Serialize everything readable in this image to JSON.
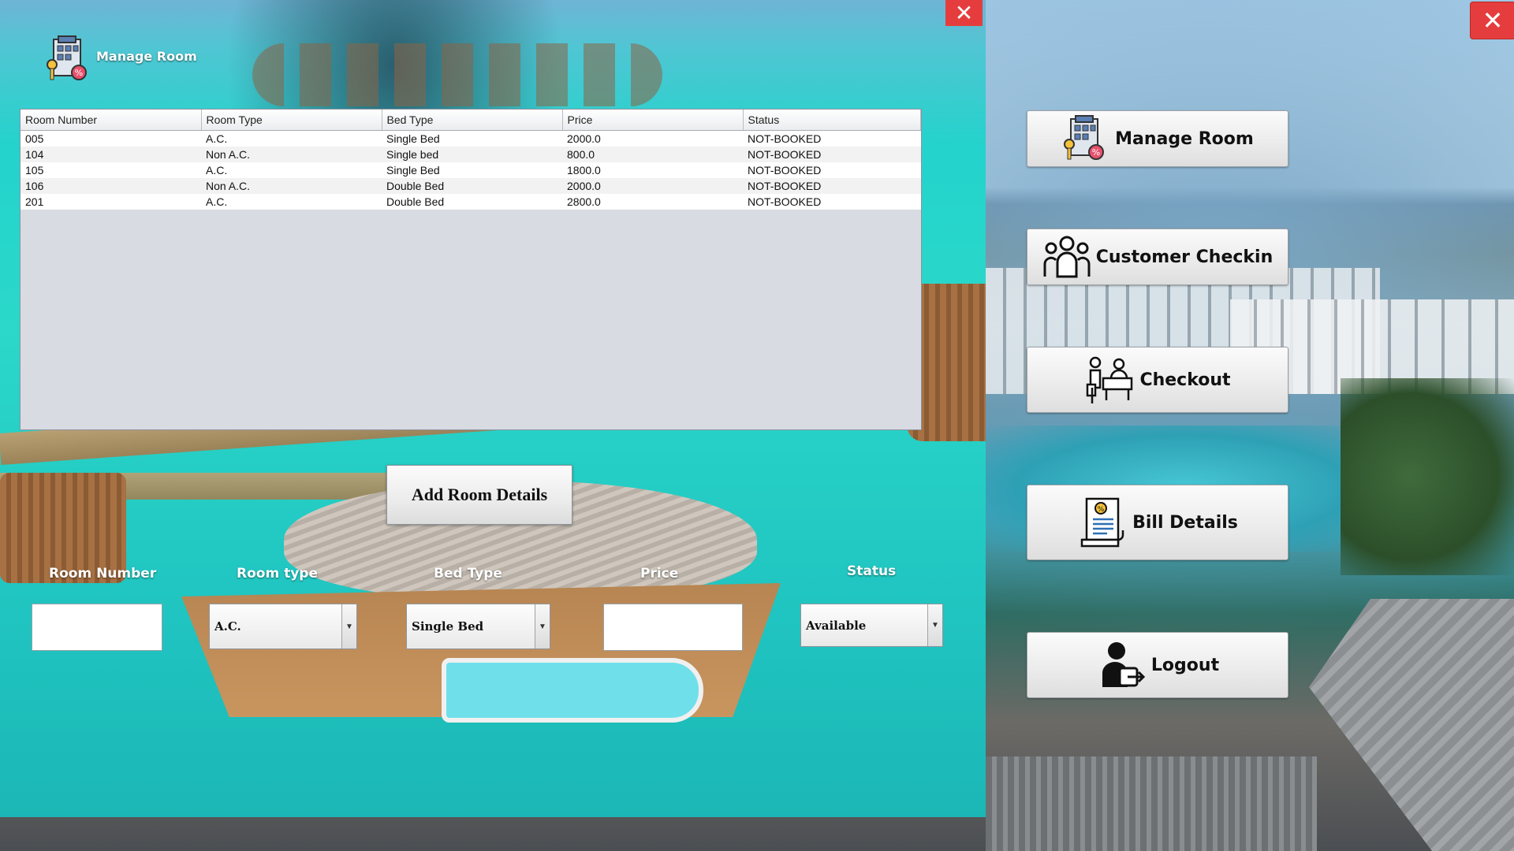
{
  "main_window": {
    "close_symbol": "✕",
    "nav": [
      {
        "label": "Manage Room",
        "icon": "hotel-key-icon"
      },
      {
        "label": "Customer Checkin",
        "icon": "group-icon"
      },
      {
        "label": "Checkout",
        "icon": "reception-desk-icon"
      },
      {
        "label": "Bill Details",
        "icon": "bill-icon"
      },
      {
        "label": "Logout",
        "icon": "logout-user-icon"
      }
    ]
  },
  "manage_room": {
    "title": "Manage Room",
    "close_symbol": "✕",
    "table": {
      "columns": [
        "Room Number",
        "Room Type",
        "Bed Type",
        "Price",
        "Status"
      ],
      "rows": [
        [
          "005",
          "A.C.",
          "Single Bed",
          "2000.0",
          "NOT-BOOKED"
        ],
        [
          "104",
          "Non A.C.",
          "Single bed",
          "800.0",
          "NOT-BOOKED"
        ],
        [
          "105",
          "A.C.",
          "Single Bed",
          "1800.0",
          "NOT-BOOKED"
        ],
        [
          "106",
          "Non A.C.",
          "Double Bed",
          "2000.0",
          "NOT-BOOKED"
        ],
        [
          "201",
          "A.C.",
          "Double Bed",
          "2800.0",
          "NOT-BOOKED"
        ]
      ]
    },
    "add_button": "Add Room Details",
    "form": {
      "room_number_label": "Room Number",
      "room_number_value": "",
      "room_type_label": "Room type",
      "room_type_value": "A.C.",
      "bed_type_label": "Bed Type",
      "bed_type_value": "Single Bed",
      "price_label": "Price",
      "price_value": "",
      "status_label": "Status",
      "status_value": "Available"
    }
  },
  "colors": {
    "close_red": "#e53d3d",
    "water": "#23d3cc"
  }
}
